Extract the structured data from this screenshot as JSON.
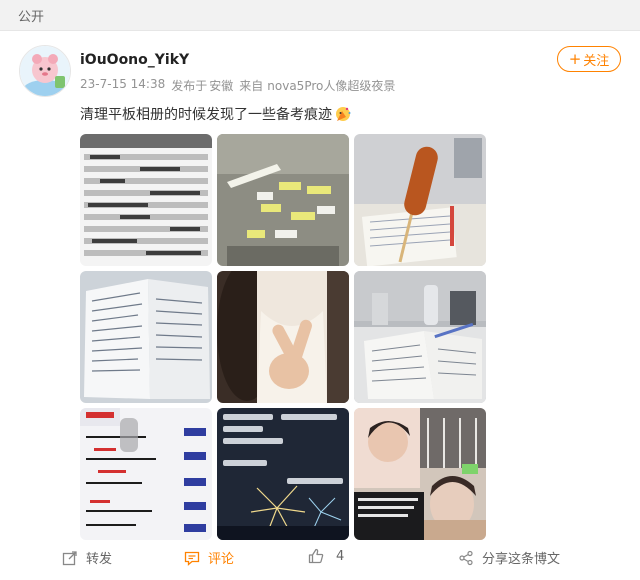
{
  "header": {
    "visibility": "公开"
  },
  "post": {
    "username": "iOuOono_YikY",
    "date": "23-7-15 14:38",
    "posted_from_label": "发布于",
    "location": "安徽",
    "source_label": "来自",
    "device": "nova5Pro人像超级夜景",
    "follow_label": "关注",
    "text": "清理平板相册的时候发现了一些备考痕迹",
    "images": [
      {
        "subject": "spreadsheet-screenshot"
      },
      {
        "subject": "wall-with-sticky-notes"
      },
      {
        "subject": "corn-dog-on-notes"
      },
      {
        "subject": "open-notebook"
      },
      {
        "subject": "peace-sign-selfie"
      },
      {
        "subject": "desk-with-notes"
      },
      {
        "subject": "handwritten-exam-notes"
      },
      {
        "subject": "fireworks-with-comments"
      },
      {
        "subject": "photo-collage"
      }
    ]
  },
  "actions": {
    "repost_label": "转发",
    "comment_label": "评论",
    "like_count": "4",
    "share_label": "分享这条博文"
  },
  "colors": {
    "accent": "#ff8200",
    "muted": "#939393",
    "topbar_bg": "#f2f2f2"
  }
}
